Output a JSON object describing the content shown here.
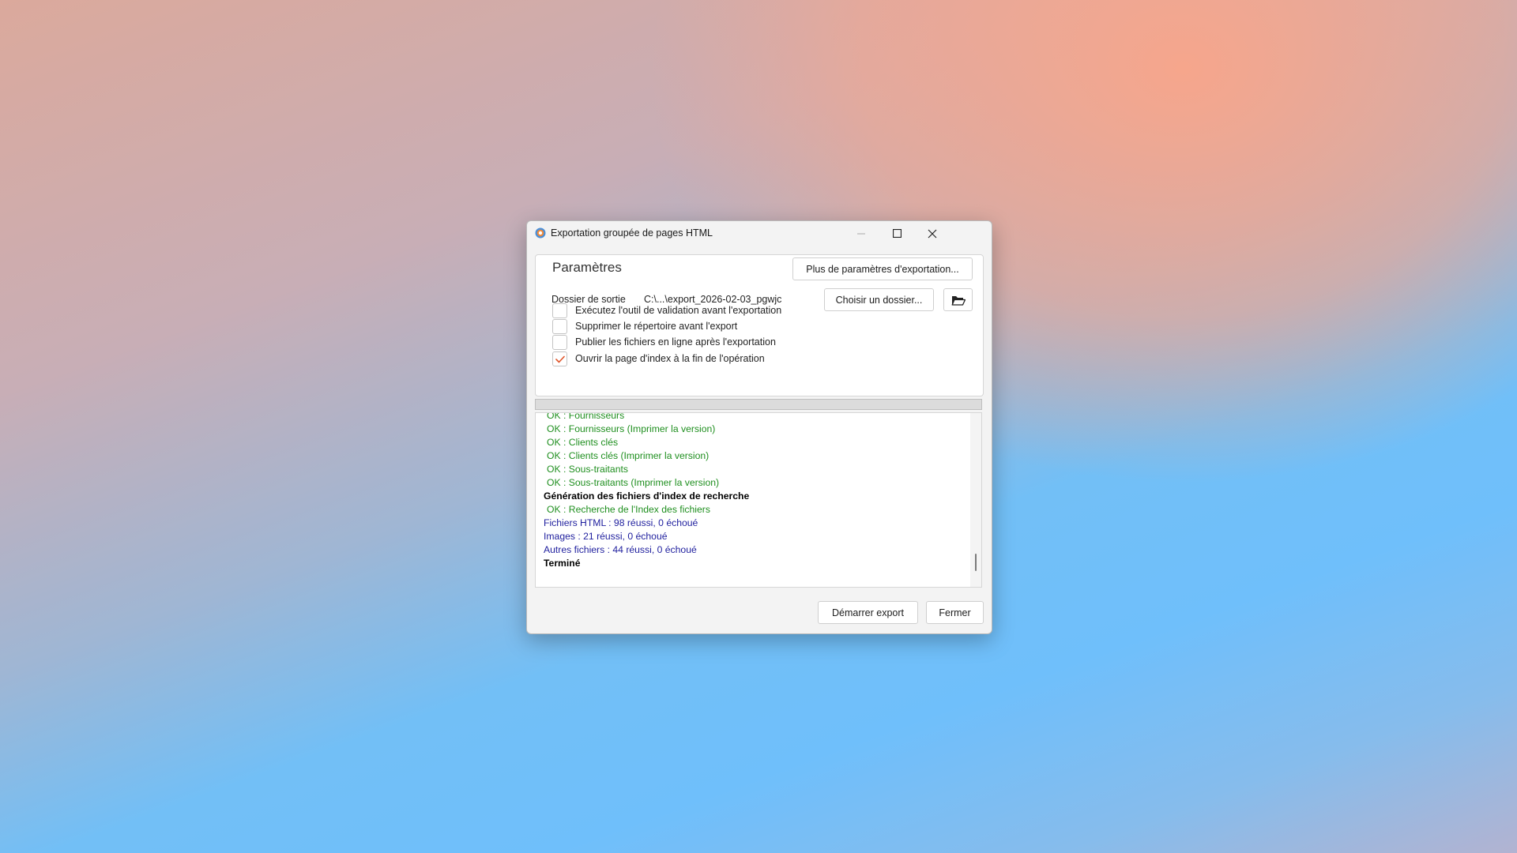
{
  "window": {
    "title": "Exportation groupée de pages HTML"
  },
  "params": {
    "title": "Paramètres",
    "more_button": "Plus de paramètres d'exportation...",
    "output_label": "Dossier de sortie",
    "output_path": "C:\\...\\export_2026-02-03_pgwjc",
    "choose_button": "Choisir un dossier...",
    "options": [
      {
        "label": "Exécutez l'outil de validation avant l'exportation",
        "checked": false
      },
      {
        "label": "Supprimer le répertoire avant l'export",
        "checked": false
      },
      {
        "label": "Publier les fichiers en ligne après l'exportation",
        "checked": false
      },
      {
        "label": "Ouvrir la page d'index à la fin de l'opération",
        "checked": true
      }
    ]
  },
  "progress": {
    "value": 0
  },
  "log": [
    {
      "type": "ok",
      "text": "OK : Fournisseurs"
    },
    {
      "type": "ok",
      "text": "OK : Fournisseurs (Imprimer la version)"
    },
    {
      "type": "ok",
      "text": "OK : Clients clés"
    },
    {
      "type": "ok",
      "text": "OK : Clients clés (Imprimer la version)"
    },
    {
      "type": "ok",
      "text": "OK : Sous-traitants"
    },
    {
      "type": "ok",
      "text": "OK : Sous-traitants (Imprimer la version)"
    },
    {
      "type": "head",
      "text": "Génération des fichiers d'index de recherche"
    },
    {
      "type": "ok",
      "text": "OK : Recherche de l'Index des fichiers"
    },
    {
      "type": "stat",
      "text": "Fichiers HTML :  98 réussi, 0 échoué"
    },
    {
      "type": "stat",
      "text": "Images :  21 réussi, 0 échoué"
    },
    {
      "type": "stat",
      "text": "Autres fichiers :  44 réussi, 0 échoué"
    },
    {
      "type": "head",
      "text": "Terminé"
    }
  ],
  "footer": {
    "start_button": "Démarrer export",
    "close_button": "Fermer"
  },
  "colors": {
    "ok": "#1f8f1f",
    "stat": "#1f1f9e",
    "check_accent": "#e0552a"
  }
}
